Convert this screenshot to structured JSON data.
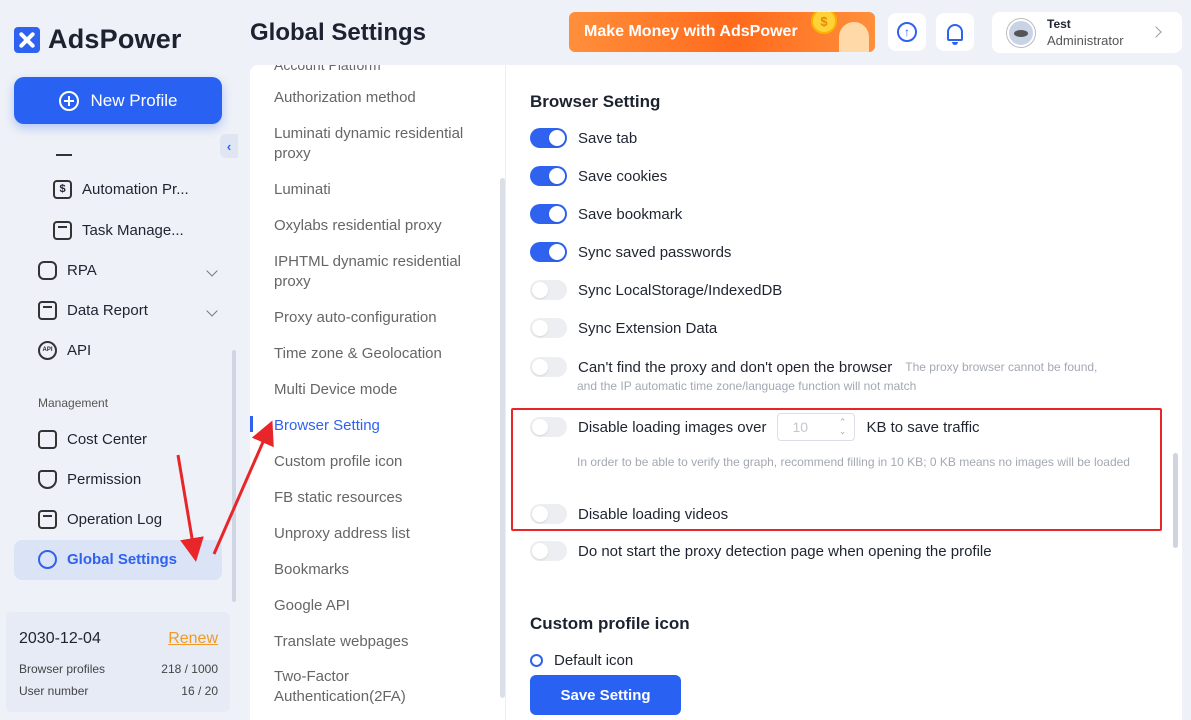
{
  "app": {
    "name": "AdsPower"
  },
  "sidebar": {
    "new_profile": "New Profile",
    "items": [
      {
        "label": "Automation Pr...",
        "icon": "dollar-receipt-icon"
      },
      {
        "label": "Task Manage...",
        "icon": "task-list-icon"
      },
      {
        "label": "RPA",
        "icon": "robot-icon"
      },
      {
        "label": "Data Report",
        "icon": "chart-icon"
      },
      {
        "label": "API",
        "icon": "api-icon"
      }
    ],
    "management_label": "Management",
    "management_items": [
      {
        "label": "Cost Center",
        "icon": "wallet-icon"
      },
      {
        "label": "Permission",
        "icon": "shield-icon"
      },
      {
        "label": "Operation Log",
        "icon": "clipboard-icon"
      },
      {
        "label": "Global Settings",
        "icon": "settings-hexagon-icon"
      }
    ],
    "plan": {
      "date": "2030-12-04",
      "renew": "Renew",
      "browser_profiles_label": "Browser profiles",
      "browser_profiles_value": "218 / 1000",
      "user_number_label": "User number",
      "user_number_value": "16 / 20"
    }
  },
  "header": {
    "title": "Global Settings",
    "banner_text": "Make Money with AdsPower",
    "user": {
      "name": "Test",
      "role": "Administrator"
    }
  },
  "settings_menu": {
    "cut_top": "Account Platform",
    "items": [
      "Authorization method",
      "Luminati dynamic residential proxy",
      "Luminati",
      "Oxylabs residential proxy",
      "IPHTML dynamic residential proxy",
      "Proxy auto-configuration",
      "Time zone & Geolocation",
      "Multi Device mode",
      "Browser Setting",
      "Custom profile icon",
      "FB static resources",
      "Unproxy address list",
      "Bookmarks",
      "Google API",
      "Translate webpages",
      "Two-Factor Authentication(2FA)"
    ],
    "active": "Browser Setting"
  },
  "browser_setting": {
    "title": "Browser Setting",
    "toggles": [
      {
        "label": "Save tab",
        "on": true
      },
      {
        "label": "Save cookies",
        "on": true
      },
      {
        "label": "Save bookmark",
        "on": true
      },
      {
        "label": "Sync saved passwords",
        "on": true
      },
      {
        "label": "Sync LocalStorage/IndexedDB",
        "on": false
      },
      {
        "label": "Sync Extension Data",
        "on": false
      },
      {
        "label": "Can't find the proxy and don't open the browser",
        "on": false
      },
      {
        "label": "Disable loading images over",
        "on": false
      },
      {
        "label": "Disable loading videos",
        "on": false
      },
      {
        "label": "Do not start the proxy detection page when opening the profile",
        "on": false
      }
    ],
    "proxy_hint_inline": "The proxy browser cannot be found,",
    "proxy_hint_line2": "and the IP automatic time zone/language function will not match",
    "images_kb_value": "10",
    "images_suffix": "KB to save traffic",
    "images_hint": "In order to be able to verify the graph, recommend filling in 10 KB; 0 KB means no images will be loaded"
  },
  "custom_icon": {
    "title": "Custom profile icon",
    "default_option": "Default icon"
  },
  "save_button": "Save Setting",
  "colors": {
    "primary": "#2962f2",
    "highlight": "#e8262a",
    "renew": "#f19a24"
  }
}
